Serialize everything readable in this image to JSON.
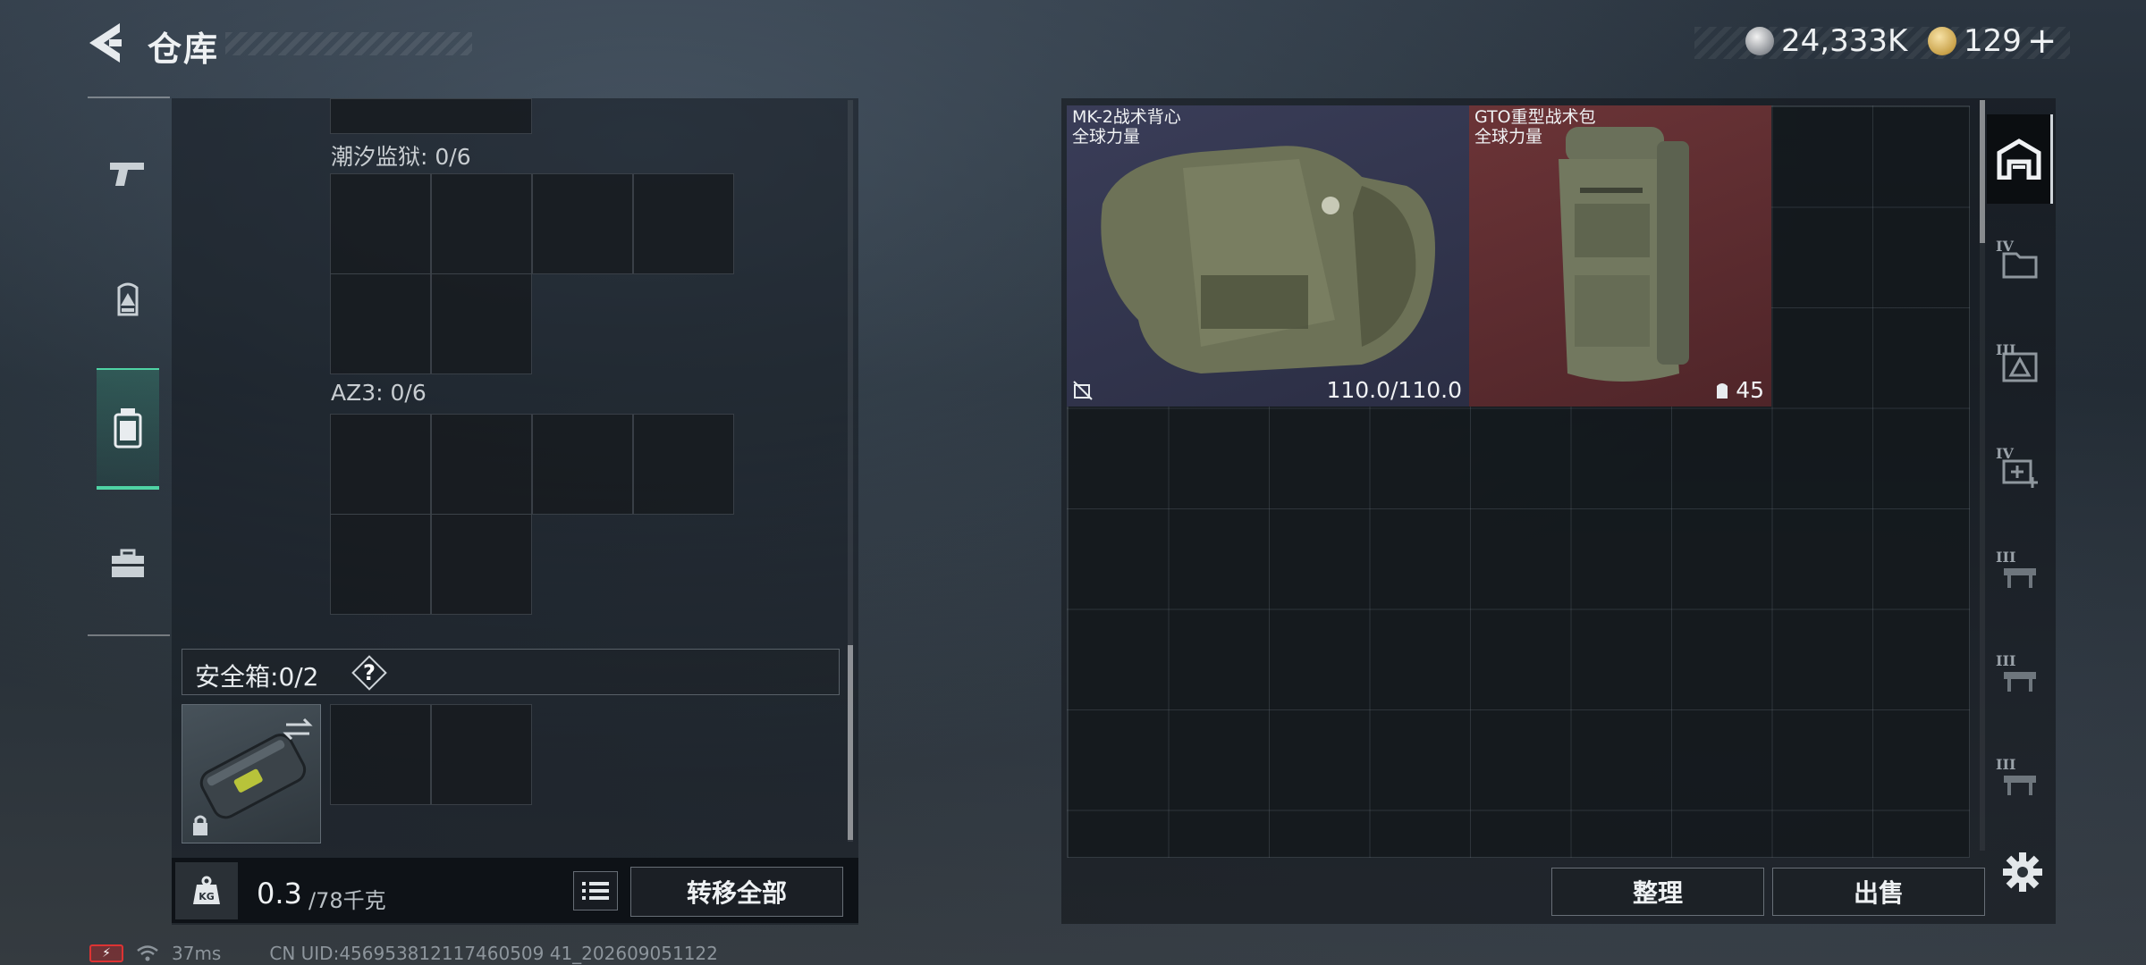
{
  "header": {
    "title": "仓库",
    "currency": [
      {
        "name": "silver-coin",
        "amount": "24,333K"
      },
      {
        "name": "gold-coin",
        "amount": "129"
      }
    ],
    "plus_label": "+"
  },
  "left_nav": {
    "items": [
      {
        "id": "weapons",
        "icon": "pistol-icon"
      },
      {
        "id": "equipment",
        "icon": "backpack-icon"
      },
      {
        "id": "containers",
        "icon": "container-icon",
        "active": true
      },
      {
        "id": "toolbox",
        "icon": "toolbox-icon"
      }
    ]
  },
  "left_panel": {
    "sections": [
      {
        "label": "潮汐监狱: 0/6"
      },
      {
        "label": "AZ3: 0/6"
      }
    ],
    "safebox": {
      "label": "安全箱:",
      "count": "0/2",
      "help": "?"
    },
    "weight": {
      "current": "0.3",
      "max": "/78千克"
    },
    "transfer_all": "转移全部"
  },
  "stash": {
    "items": [
      {
        "name": "MK-2战术背心",
        "faction": "全球力量",
        "value": "110.0/110.0",
        "rarity_color": "#34364f",
        "foot_icon": "no-repair-icon"
      },
      {
        "name": "GTO重型战术包",
        "faction": "全球力量",
        "value": "45",
        "rarity_color": "#5c2b2f",
        "foot_icon": "backpack-capacity-icon"
      }
    ],
    "sort_label": "整理",
    "sell_label": "出售"
  },
  "right_tabs": [
    {
      "roman": "",
      "icon": "warehouse-icon",
      "active": true
    },
    {
      "roman": "IV",
      "icon": "folder-icon"
    },
    {
      "roman": "III",
      "icon": "triangle-crate-icon"
    },
    {
      "roman": "IV",
      "icon": "medkit-icon"
    },
    {
      "roman": "III",
      "icon": "workbench-icon"
    },
    {
      "roman": "III",
      "icon": "workbench-icon"
    },
    {
      "roman": "III",
      "icon": "workbench-icon"
    }
  ],
  "status": {
    "battery": "⚡",
    "ping": "37ms",
    "uid": "CN UID:456953812117460509 41_202609051122"
  }
}
